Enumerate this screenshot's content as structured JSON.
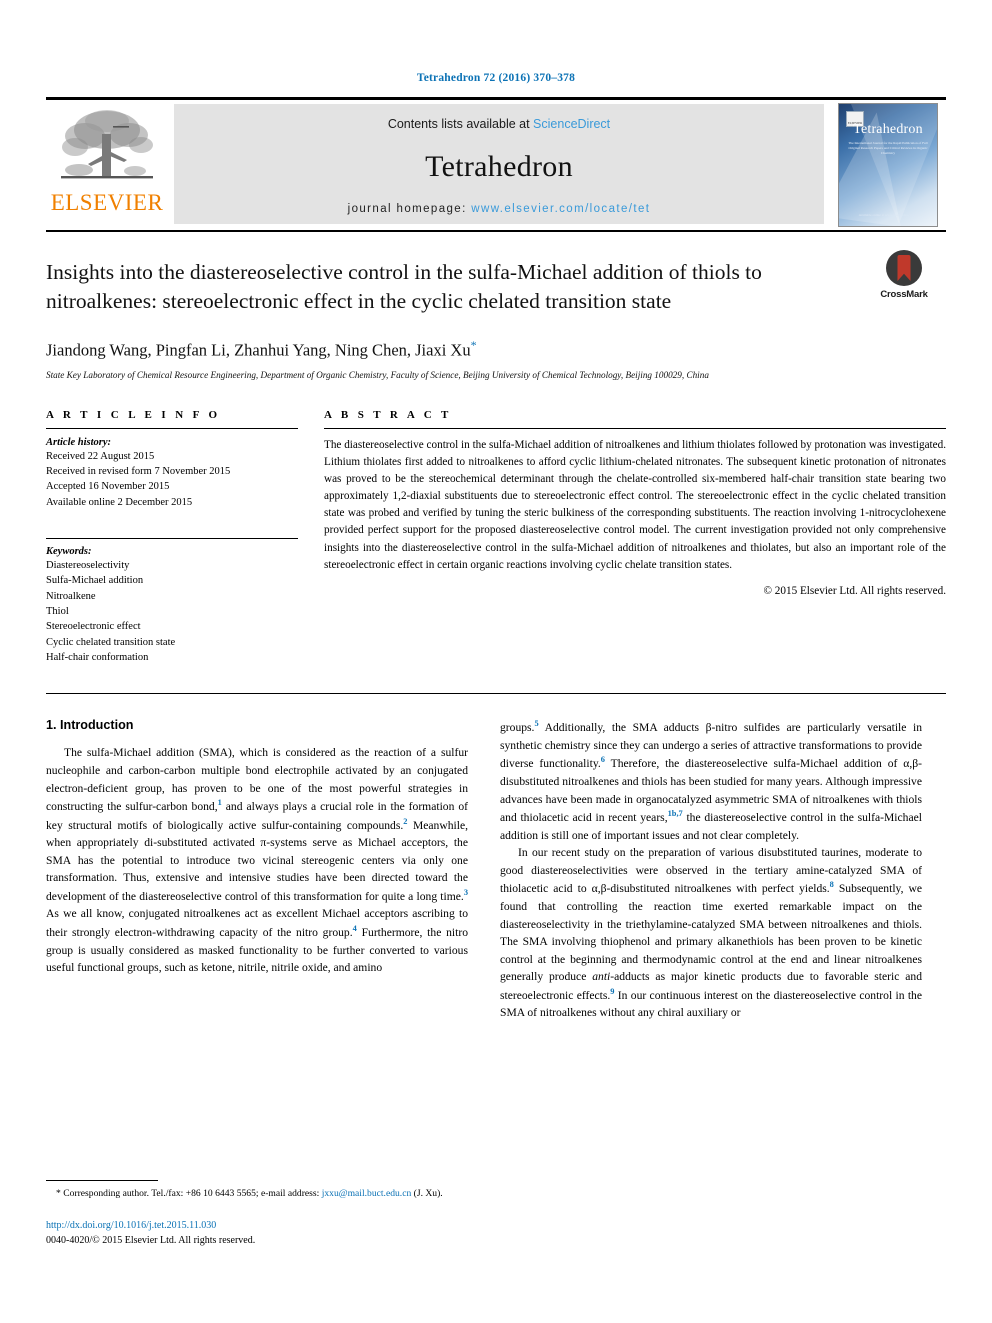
{
  "running_head": "Tetrahedron 72 (2016) 370–378",
  "masthead": {
    "publisher_word": "ELSEVIER",
    "contents_prefix": "Contents lists available at ",
    "contents_link": "ScienceDirect",
    "journal_name": "Tetrahedron",
    "homepage_prefix": "journal homepage: ",
    "homepage_url": "www.elsevier.com/locate/tet",
    "cover": {
      "title": "Tetrahedron",
      "subtitle": "The International Journal for the Rapid Publication of Full Original Research Papers and Critical Reviews in Organic Chemistry",
      "footer": "Available online at www.sciencedirect.com",
      "badge_word": "ELSEVIER"
    }
  },
  "article": {
    "title": "Insights into the diastereoselective control in the sulfa-Michael addition of thiols to nitroalkenes: stereoelectronic effect in the cyclic chelated transition state",
    "crossmark_label": "CrossMark",
    "authors": "Jiandong Wang, Pingfan Li, Zhanhui Yang, Ning Chen, Jiaxi Xu",
    "corresponding_marker": "*",
    "affiliation": "State Key Laboratory of Chemical Resource Engineering, Department of Organic Chemistry, Faculty of Science, Beijing University of Chemical Technology, Beijing 100029, China"
  },
  "info": {
    "heading": "A R T I C L E   I N F O",
    "history_label": "Article history:",
    "history": [
      "Received 22 August 2015",
      "Received in revised form 7 November 2015",
      "Accepted 16 November 2015",
      "Available online 2 December 2015"
    ],
    "keywords_label": "Keywords:",
    "keywords": [
      "Diastereoselectivity",
      "Sulfa-Michael addition",
      "Nitroalkene",
      "Thiol",
      "Stereoelectronic effect",
      "Cyclic chelated transition state",
      "Half-chair conformation"
    ]
  },
  "abstract": {
    "heading": "A B S T R A C T",
    "text": "The diastereoselective control in the sulfa-Michael addition of nitroalkenes and lithium thiolates followed by protonation was investigated. Lithium thiolates first added to nitroalkenes to afford cyclic lithium-chelated nitronates. The subsequent kinetic protonation of nitronates was proved to be the stereochemical determinant through the chelate-controlled six-membered half-chair transition state bearing two approximately 1,2-diaxial substituents due to stereoelectronic effect control. The stereoelectronic effect in the cyclic chelated transition state was probed and verified by tuning the steric bulkiness of the corresponding substituents. The reaction involving 1-nitrocyclohexene provided perfect support for the proposed diastereoselective control model. The current investigation provided not only comprehensive insights into the diastereoselective control in the sulfa-Michael addition of nitroalkenes and thiolates, but also an important role of the stereoelectronic effect in certain organic reactions involving cyclic chelate transition states.",
    "copyright": "© 2015 Elsevier Ltd. All rights reserved."
  },
  "body": {
    "section_heading": "1. Introduction",
    "left_paragraph_1": {
      "p1": "The sulfa-Michael addition (SMA), which is considered as the reaction of a sulfur nucleophile and carbon-carbon multiple bond electrophile activated by an conjugated electron-deficient group, has proven to be one of the most powerful strategies in constructing the sulfur-carbon bond,",
      "r1": "1",
      "p2": " and always plays a crucial role in the formation of key structural motifs of biologically active sulfur-containing compounds.",
      "r2": "2",
      "p3": " Meanwhile, when appropriately di-substituted activated π-systems serve as Michael acceptors, the SMA has the potential to introduce two vicinal stereogenic centers via only one transformation. Thus, extensive and intensive studies have been directed toward the development of the diastereoselective control of this transformation for quite a long time.",
      "r3": "3",
      "p4": " As we all know, conjugated nitroalkenes act as excellent Michael acceptors ascribing to their strongly electron-withdrawing capacity of the nitro group.",
      "r4": "4",
      "p5": " Furthermore, the nitro group is usually considered as masked functionality to be further converted to various useful functional groups, such as ketone, nitrile, nitrile oxide, and amino"
    },
    "right_paragraph_1": {
      "p1": "groups.",
      "r1": "5",
      "p2": " Additionally, the SMA adducts β-nitro sulfides are particularly versatile in synthetic chemistry since they can undergo a series of attractive transformations to provide diverse functionality.",
      "r2": "6",
      "p3": " Therefore, the diastereoselective sulfa-Michael addition of α,β-disubstituted nitroalkenes and thiols has been studied for many years. Although impressive advances have been made in organocatalyzed asymmetric SMA of nitroalkenes with thiols and thiolacetic acid in recent years,",
      "r3": "1b,7",
      "p4": " the diastereoselective control in the sulfa-Michael addition is still one of important issues and not clear completely."
    },
    "right_paragraph_2": {
      "p1": "In our recent study on the preparation of various disubstituted taurines, moderate to good diastereoselectivities were observed in the tertiary amine-catalyzed SMA of thiolacetic acid to α,β-disubstituted nitroalkenes with perfect yields.",
      "r1": "8",
      "p2": " Subsequently, we found that controlling the reaction time exerted remarkable impact on the diastereoselectivity in the triethylamine-catalyzed SMA between nitroalkenes and thiols. The SMA involving thiophenol and primary alkanethiols has been proven to be kinetic control at the beginning and thermodynamic control at the end and linear nitroalkenes generally produce ",
      "ital1": "anti",
      "p3": "-adducts as major kinetic products due to favorable steric and stereoelectronic effects.",
      "r2": "9",
      "p4": " In our continuous interest on the diastereoselective control in the SMA of nitroalkenes without any chiral auxiliary or"
    }
  },
  "footnotes": {
    "corresponding_marker": "*",
    "corresponding_text": " Corresponding author. Tel./fax: +86 10 6443 5565; e-mail address: ",
    "email": "jxxu@mail.buct.edu.cn",
    "corresponding_suffix": " (J. Xu).",
    "doi": "http://dx.doi.org/10.1016/j.tet.2015.11.030",
    "issn_copyright": "0040-4020/© 2015 Elsevier Ltd. All rights reserved."
  },
  "colors": {
    "link_blue": "#0b72b5",
    "sciencedirect_blue": "#3a9ad9",
    "elsevier_orange": "#f08000",
    "banner_gray": "#e3e3e3"
  }
}
